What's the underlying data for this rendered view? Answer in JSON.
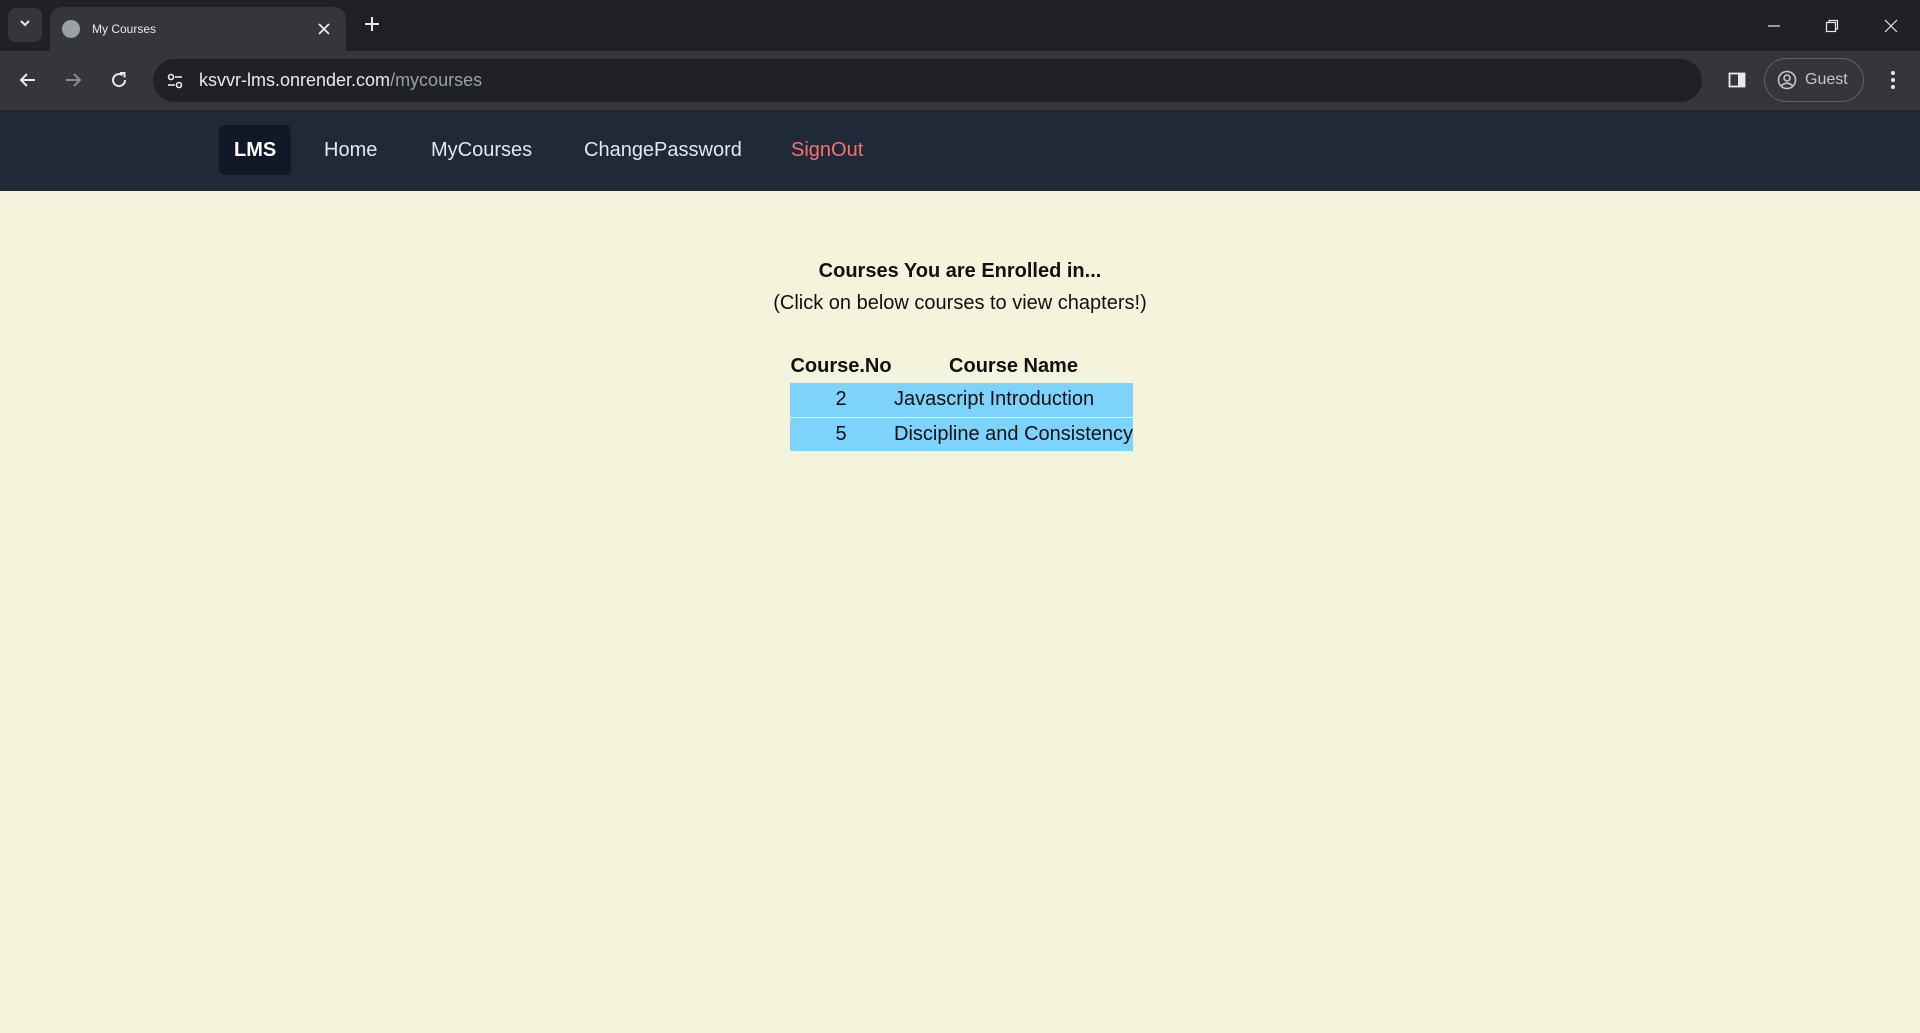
{
  "browser": {
    "tab_title": "My Courses",
    "url_host": "ksvvr-lms.onrender.com",
    "url_path": "/mycourses",
    "profile_label": "Guest"
  },
  "nav": {
    "brand": "LMS",
    "links": [
      "Home",
      "MyCourses",
      "ChangePassword"
    ],
    "signout": "SignOut",
    "colors": {
      "background": "#1f2937",
      "brand_bg": "#111827",
      "signout": "#f87171"
    }
  },
  "main": {
    "title": "Courses You are Enrolled in...",
    "subtitle": "(Click on below courses to view chapters!)",
    "table": {
      "headers": [
        "Course.No",
        "Course Name"
      ],
      "rows": [
        {
          "no": "2",
          "name": "Javascript Introduction"
        },
        {
          "no": "5",
          "name": "Discipline and Consistency"
        }
      ],
      "row_color": "#7dd3fc"
    }
  },
  "icons": {
    "tab_search": "chevron-down-icon",
    "favicon": "globe-icon",
    "tab_close": "close-icon",
    "new_tab": "plus-icon",
    "back": "arrow-left-icon",
    "forward": "arrow-right-icon",
    "reload": "reload-icon",
    "site_info": "tune-icon",
    "side_panel": "side-panel-icon",
    "profile": "account-circle-icon",
    "menu": "kebab-menu-icon"
  }
}
